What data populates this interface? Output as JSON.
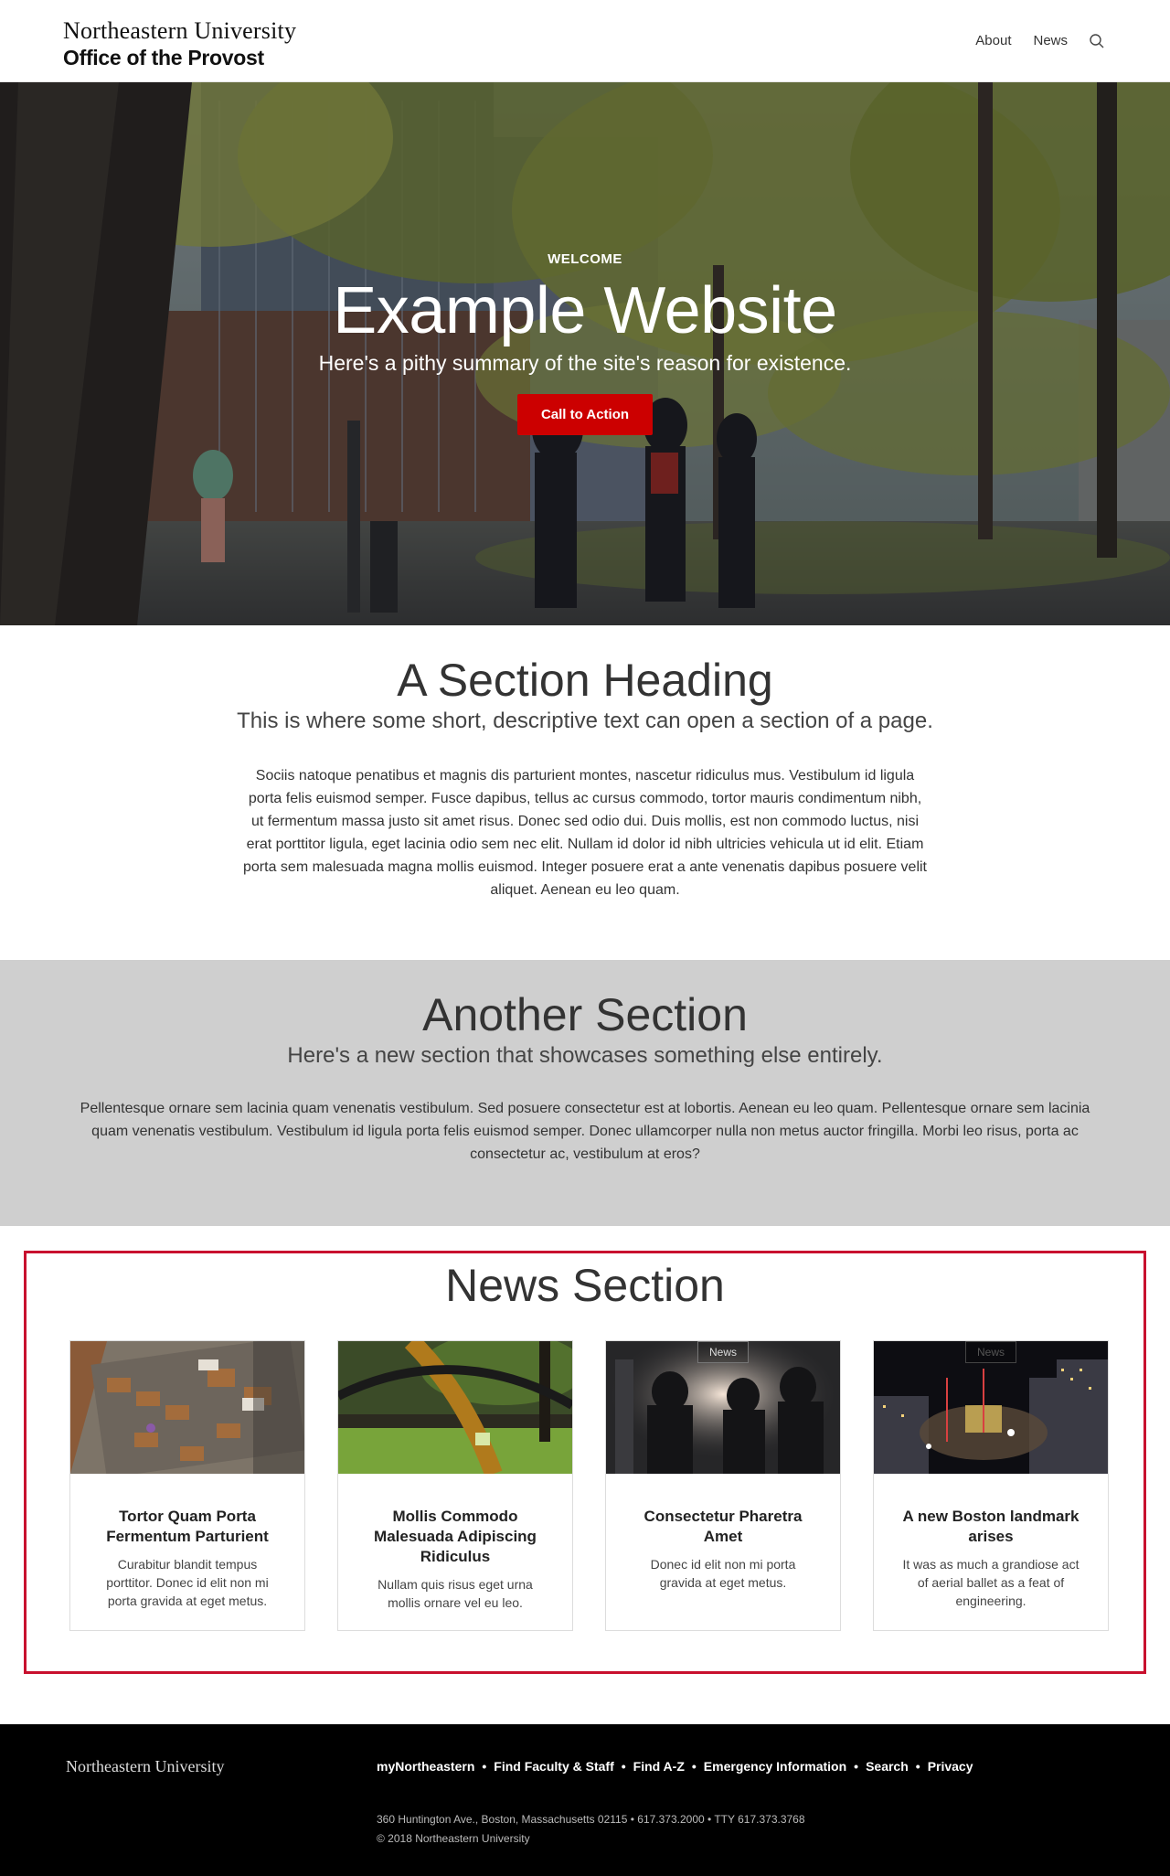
{
  "header": {
    "university": "Northeastern University",
    "office": "Office of the Provost",
    "nav": [
      {
        "label": "About"
      },
      {
        "label": "News"
      }
    ],
    "search_icon": "search-icon"
  },
  "hero": {
    "eyebrow": "WELCOME",
    "title": "Example Website",
    "summary": "Here's a pithy summary of the site's reason for existence.",
    "cta": "Call to Action",
    "cta_color": "#cc0000"
  },
  "section_one": {
    "heading": "A Section Heading",
    "subheading": "This is where some short, descriptive text can open a section of a page.",
    "body": "Sociis natoque penatibus et magnis dis parturient montes, nascetur ridiculus mus. Vestibulum id ligula porta felis euismod semper. Fusce dapibus, tellus ac cursus commodo, tortor mauris condimentum nibh, ut fermentum massa justo sit amet risus. Donec sed odio dui. Duis mollis, est non commodo luctus, nisi erat porttitor ligula, eget lacinia odio sem nec elit. Nullam id dolor id nibh ultricies vehicula ut id elit. Etiam porta sem malesuada magna mollis euismod. Integer posuere erat a ante venenatis dapibus posuere velit aliquet. Aenean eu leo quam."
  },
  "section_two": {
    "heading": "Another Section",
    "subheading": "Here's a new section that showcases something else entirely.",
    "body": "Pellentesque ornare sem lacinia quam venenatis vestibulum. Sed posuere consectetur est at lobortis. Aenean eu leo quam. Pellentesque ornare sem lacinia quam venenatis vestibulum. Vestibulum id ligula porta felis euismod semper. Donec ullamcorper nulla non metus auctor fringilla. Morbi leo risus, porta ac consectetur ac, vestibulum at eros?"
  },
  "news": {
    "heading": "News Section",
    "border_color": "#c8102e",
    "cards": [
      {
        "tag": "",
        "title": "Tortor Quam Porta Fermentum Parturient",
        "text": "Curabitur blandit tempus porttitor. Donec id elit non mi porta gravida at eget metus."
      },
      {
        "tag": "",
        "title": "Mollis Commodo Malesuada Adipiscing Ridiculus",
        "text": "Nullam quis risus eget urna mollis ornare vel eu leo."
      },
      {
        "tag": "News",
        "title": "Consectetur Pharetra Amet",
        "text": "Donec id elit non mi porta gravida at eget metus."
      },
      {
        "tag": "News",
        "title": "A new Boston landmark arises",
        "text": "It was as much a grandiose act of aerial ballet as a feat of engineering."
      }
    ]
  },
  "footer": {
    "logo": "Northeastern University",
    "links": [
      "myNortheastern",
      "Find Faculty & Staff",
      "Find A-Z",
      "Emergency Information",
      "Search",
      "Privacy"
    ],
    "separator": "•",
    "address": "360 Huntington Ave., Boston, Massachusetts 02115  •  617.373.2000  •  TTY 617.373.3768",
    "copyright": "© 2018 Northeastern University"
  }
}
